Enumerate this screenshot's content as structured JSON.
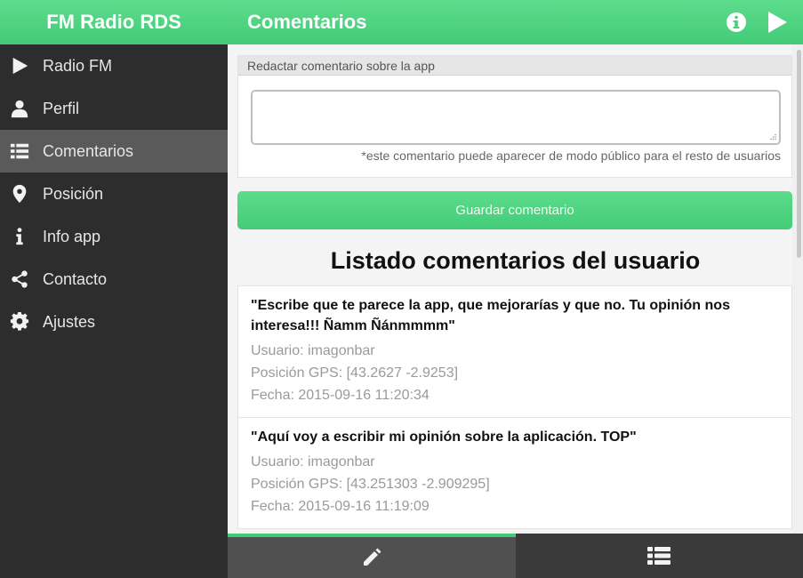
{
  "app": {
    "title": "FM Radio RDS"
  },
  "sidebar": {
    "items": [
      {
        "label": "Radio FM",
        "icon": "play-icon"
      },
      {
        "label": "Perfil",
        "icon": "user-icon"
      },
      {
        "label": "Comentarios",
        "icon": "list-icon",
        "active": true
      },
      {
        "label": "Posición",
        "icon": "map-marker-icon"
      },
      {
        "label": "Info app",
        "icon": "info-icon"
      },
      {
        "label": "Contacto",
        "icon": "share-icon"
      },
      {
        "label": "Ajustes",
        "icon": "gear-icon"
      }
    ]
  },
  "header": {
    "title": "Comentarios",
    "info_icon": "info-circle-icon",
    "play_icon": "play-icon"
  },
  "form": {
    "legend": "Redactar comentario sobre la app",
    "textarea_value": "",
    "note": "*este comentario puede aparecer de modo público para el resto de usuarios",
    "save_label": "Guardar comentario"
  },
  "list": {
    "title": "Listado comentarios del usuario",
    "comments": [
      {
        "text": "\"Escribe que te parece la app, que mejorarías y que no. Tu opinión nos interesa!!! Ñamm Ñánmmmm\"",
        "user": "Usuario: imagonbar",
        "gps": "Posición GPS: [43.2627 -2.9253]",
        "date": "Fecha: 2015-09-16 11:20:34"
      },
      {
        "text": "\"Aquí voy a escribir mi opinión sobre la aplicación. TOP\"",
        "user": "Usuario: imagonbar",
        "gps": "Posición GPS: [43.251303 -2.909295]",
        "date": "Fecha: 2015-09-16 11:19:09"
      }
    ]
  },
  "tabs": [
    {
      "name": "write",
      "icon": "pencil-icon",
      "active": true
    },
    {
      "name": "list",
      "icon": "list-icon",
      "active": false
    }
  ],
  "colors": {
    "accent": "#4fd682",
    "sidebar_bg": "#2d2d2d",
    "active_item": "#5a5a5a"
  }
}
